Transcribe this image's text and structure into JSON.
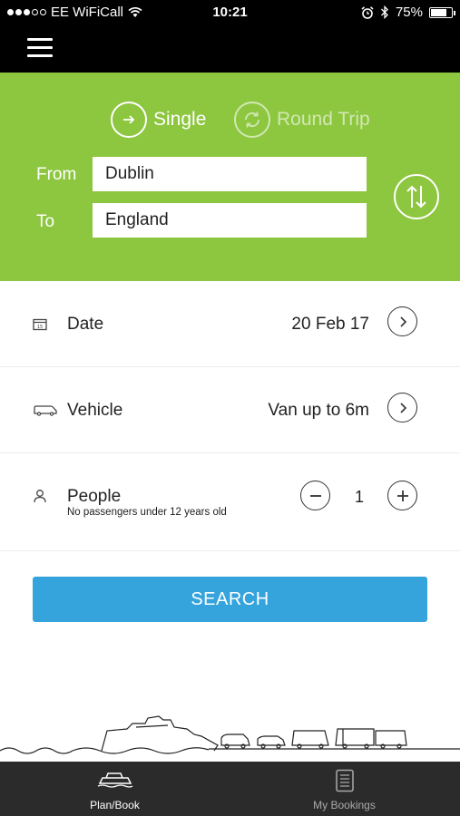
{
  "status_bar": {
    "carrier": "EE WiFiCall",
    "time": "10:21",
    "battery": "75%",
    "battery_level": 0.75
  },
  "trip_type": {
    "single_label": "Single",
    "round_trip_label": "Round Trip",
    "selected": "single"
  },
  "route": {
    "from_label": "From",
    "from_value": "Dublin",
    "to_label": "To",
    "to_value": "England"
  },
  "date": {
    "label": "Date",
    "value": "20 Feb 17"
  },
  "vehicle": {
    "label": "Vehicle",
    "value": "Van up to 6m"
  },
  "people": {
    "label": "People",
    "note": "No passengers under 12 years old",
    "count": "1"
  },
  "search_label": "SEARCH",
  "tabs": [
    {
      "label": "Plan/Book",
      "icon": "ship-icon",
      "active": true
    },
    {
      "label": "My Bookings",
      "icon": "document-icon",
      "active": false
    }
  ],
  "colors": {
    "accent_green": "#8dc63f",
    "search_blue": "#35a3dc",
    "tab_bar": "#2b2b2b"
  }
}
